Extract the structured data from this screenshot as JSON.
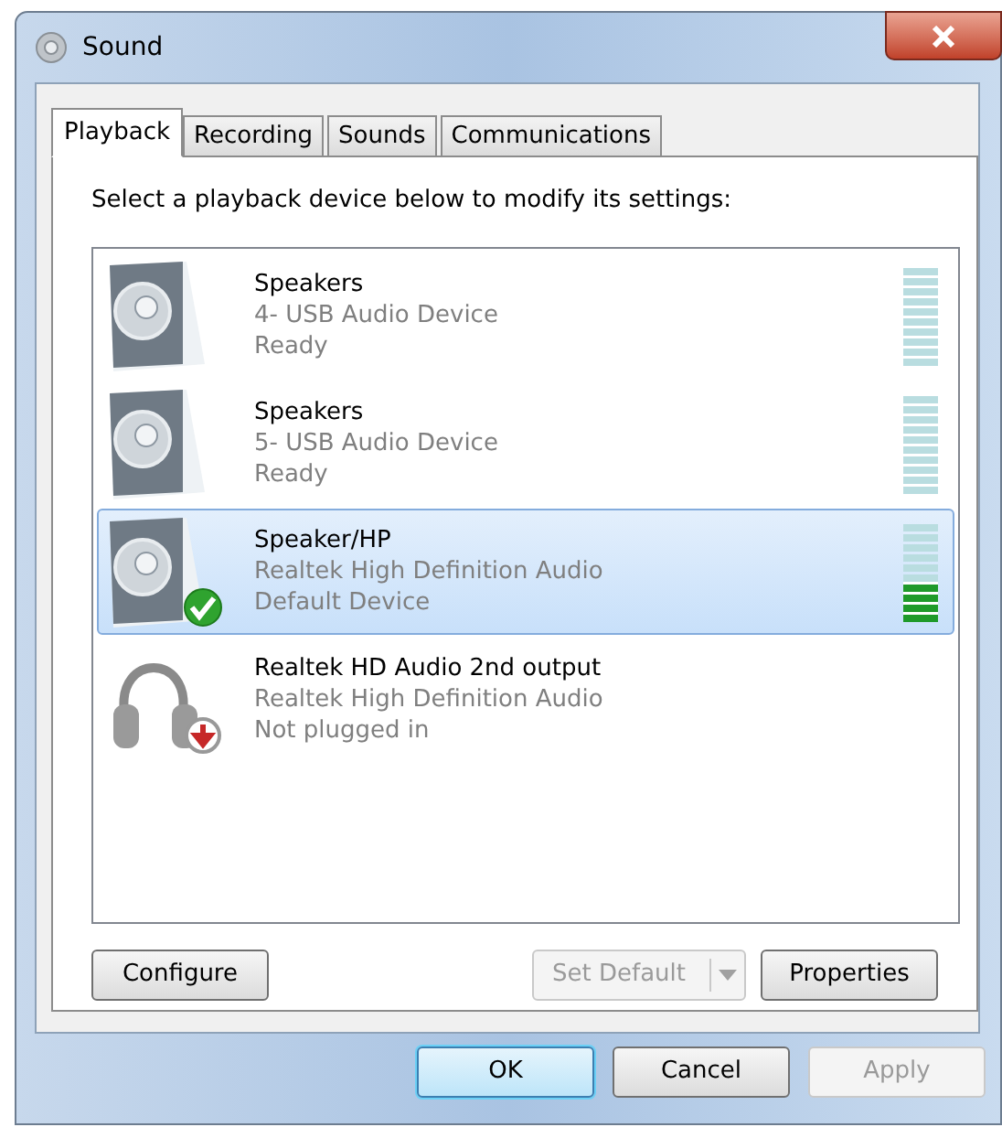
{
  "window": {
    "title": "Sound"
  },
  "tabs": [
    {
      "label": "Playback",
      "selected": true
    },
    {
      "label": "Recording",
      "selected": false
    },
    {
      "label": "Sounds",
      "selected": false
    },
    {
      "label": "Communications",
      "selected": false
    }
  ],
  "instruction": "Select a playback device below to modify its settings:",
  "devices": [
    {
      "kind": "speaker",
      "name": "Speakers",
      "driver": "4- USB Audio Device",
      "status": "Ready",
      "selected": false,
      "is_default": false,
      "unplugged": false,
      "level": 0
    },
    {
      "kind": "speaker",
      "name": "Speakers",
      "driver": "5- USB Audio Device",
      "status": "Ready",
      "selected": false,
      "is_default": false,
      "unplugged": false,
      "level": 0
    },
    {
      "kind": "speaker",
      "name": "Speaker/HP",
      "driver": "Realtek High Definition Audio",
      "status": "Default Device",
      "selected": true,
      "is_default": true,
      "unplugged": false,
      "level": 0.4
    },
    {
      "kind": "headphones",
      "name": "Realtek HD Audio 2nd output",
      "driver": "Realtek High Definition Audio",
      "status": "Not plugged in",
      "selected": false,
      "is_default": false,
      "unplugged": true
    }
  ],
  "panel_buttons": [
    {
      "label": "Configure",
      "disabled": false,
      "kind": "plain"
    },
    {
      "label": "Set Default",
      "disabled": true,
      "kind": "split"
    },
    {
      "label": "Properties",
      "disabled": false,
      "kind": "plain"
    }
  ],
  "dialog_buttons": [
    {
      "label": "OK",
      "disabled": false,
      "default": true
    },
    {
      "label": "Cancel",
      "disabled": false,
      "default": false
    },
    {
      "label": "Apply",
      "disabled": true,
      "default": false
    }
  ]
}
